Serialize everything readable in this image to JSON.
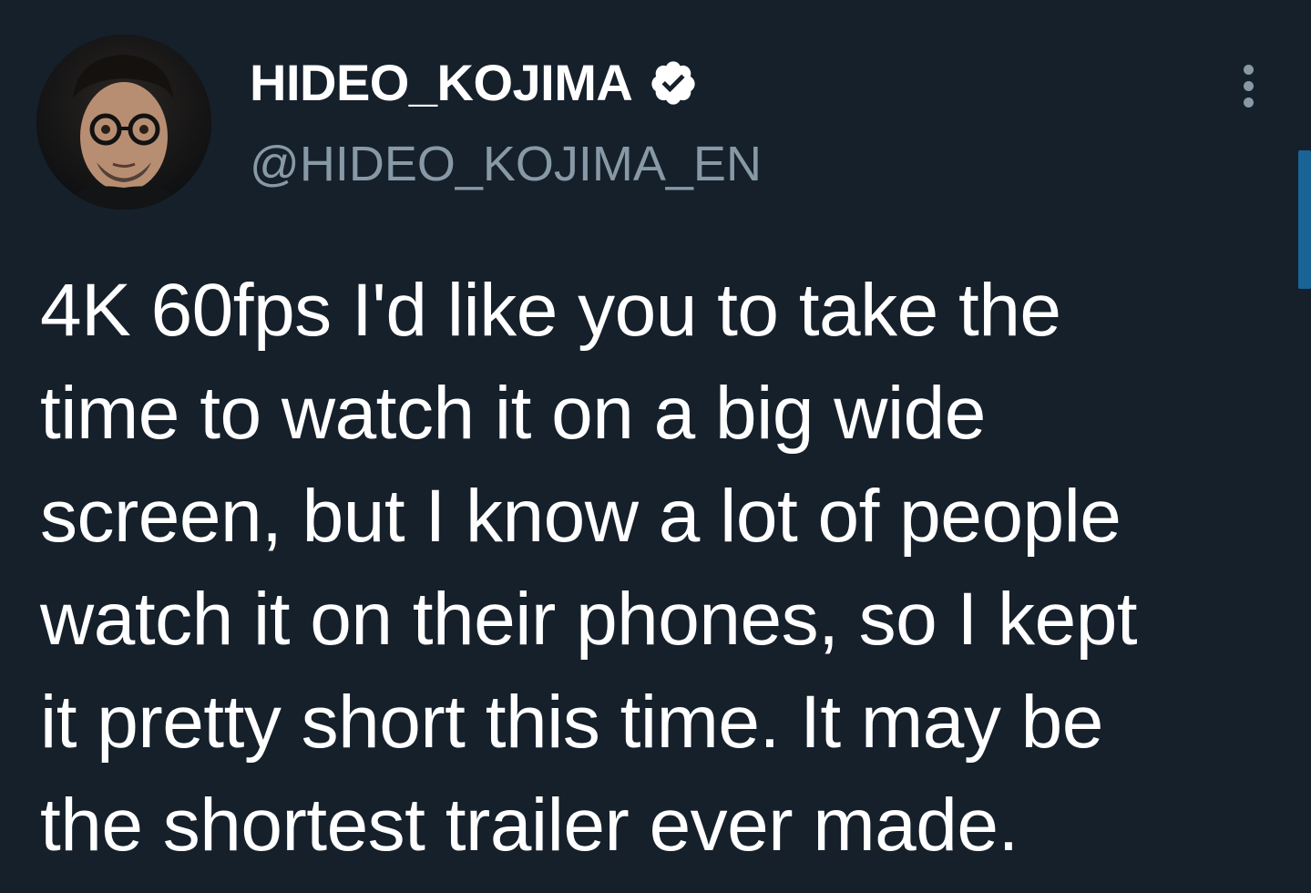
{
  "tweet": {
    "author": {
      "display_name": "HIDEO_KOJIMA",
      "handle": "@HIDEO_KOJIMA_EN",
      "verified": true,
      "avatar_icon": "profile-photo"
    },
    "text_lines": [
      "4K 60fps I'd like you to take the",
      "time to watch it on a big wide",
      "screen, but I know a lot of people",
      "watch it on their phones, so I kept",
      "it pretty short this time. It may be",
      "the shortest trailer ever made."
    ],
    "more_icon": "more-vertical-icon",
    "verified_icon": "verified-badge-icon"
  },
  "colors": {
    "background": "#15202b",
    "text_primary": "#ffffff",
    "text_secondary": "#8899a6",
    "accent": "#1d9bf0"
  }
}
